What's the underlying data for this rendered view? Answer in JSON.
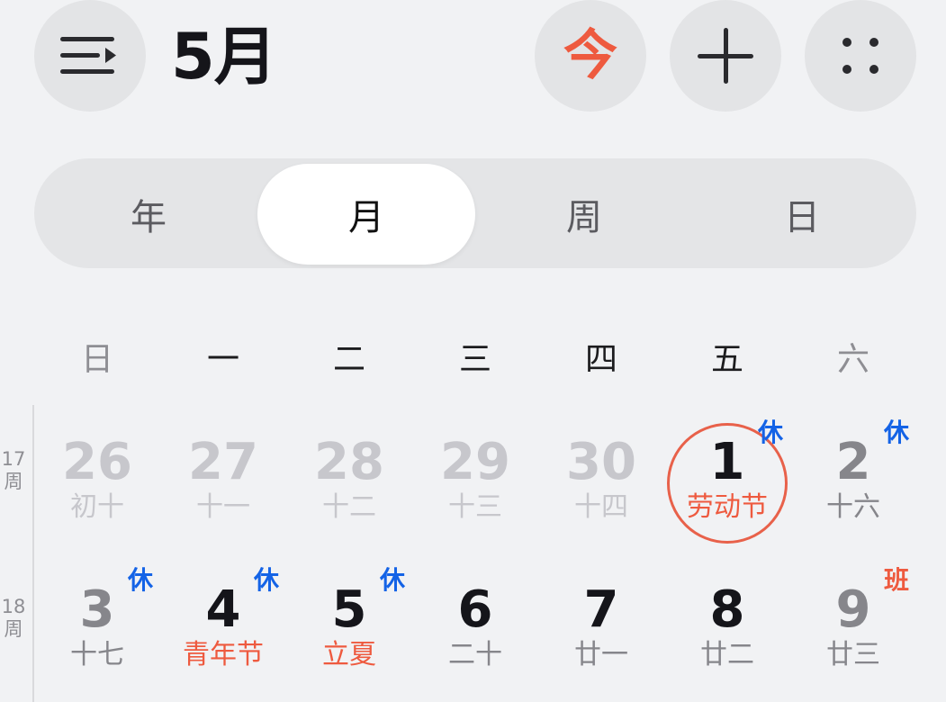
{
  "header": {
    "title": "5月",
    "today_label": "今"
  },
  "view_tabs": [
    {
      "label": "年",
      "active": false
    },
    {
      "label": "月",
      "active": true
    },
    {
      "label": "周",
      "active": false
    },
    {
      "label": "日",
      "active": false
    }
  ],
  "weekdays": [
    "日",
    "一",
    "二",
    "三",
    "四",
    "五",
    "六"
  ],
  "weeks": [
    {
      "week_label": [
        "17",
        "周"
      ],
      "days": [
        {
          "day": "26",
          "lunar": "初十",
          "other_month": true
        },
        {
          "day": "27",
          "lunar": "十一",
          "other_month": true
        },
        {
          "day": "28",
          "lunar": "十二",
          "other_month": true
        },
        {
          "day": "29",
          "lunar": "十三",
          "other_month": true
        },
        {
          "day": "30",
          "lunar": "十四",
          "other_month": true
        },
        {
          "day": "1",
          "lunar": "劳动节",
          "festival": true,
          "badge": "休",
          "today": true
        },
        {
          "day": "2",
          "lunar": "十六",
          "badge": "休"
        }
      ]
    },
    {
      "week_label": [
        "18",
        "周"
      ],
      "days": [
        {
          "day": "3",
          "lunar": "十七",
          "badge": "休"
        },
        {
          "day": "4",
          "lunar": "青年节",
          "festival": true,
          "badge": "休"
        },
        {
          "day": "5",
          "lunar": "立夏",
          "festival": true,
          "badge": "休"
        },
        {
          "day": "6",
          "lunar": "二十"
        },
        {
          "day": "7",
          "lunar": "廿一"
        },
        {
          "day": "8",
          "lunar": "廿二"
        },
        {
          "day": "9",
          "lunar": "廿三",
          "badge": "班"
        }
      ]
    }
  ],
  "colors": {
    "accent_red": "#ee5a3f",
    "rest_badge_blue": "#1463e6",
    "work_badge_red": "#ee5a3f",
    "weekend_day": "#86868b",
    "other_month": "#c7c7cc"
  }
}
